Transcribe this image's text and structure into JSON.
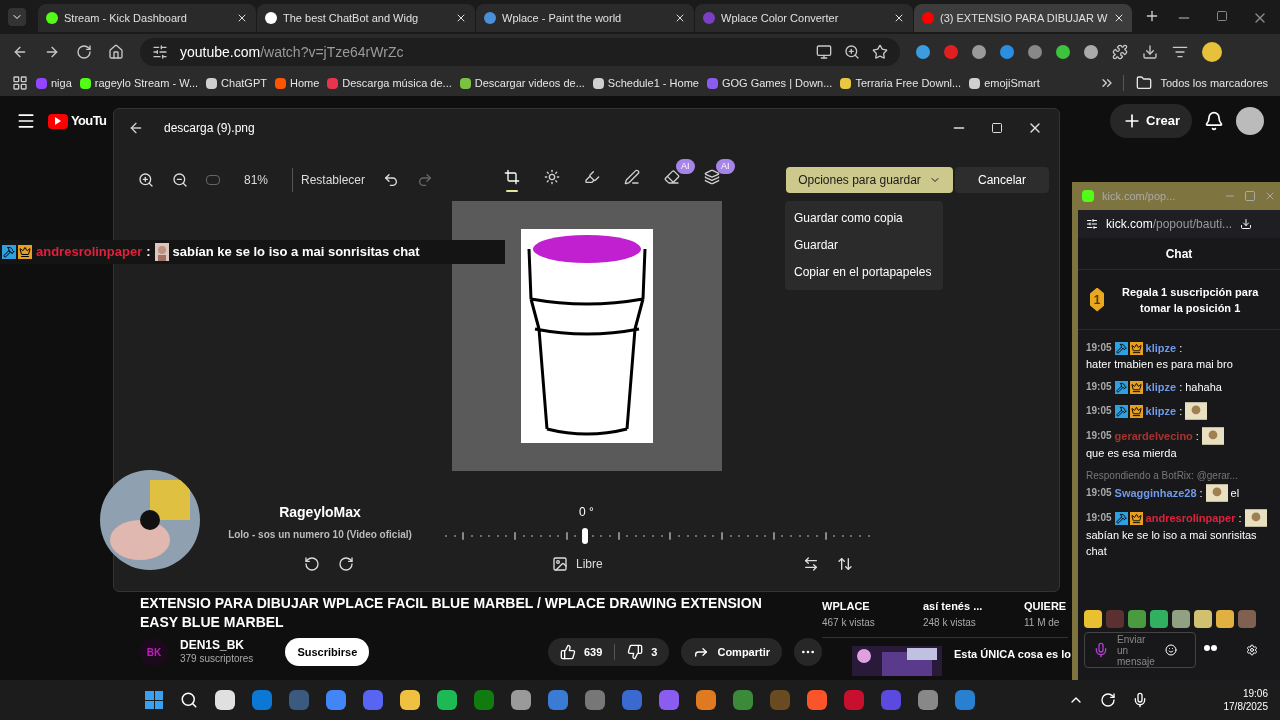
{
  "browser": {
    "tabs": [
      {
        "title": "Stream - Kick Dashboard",
        "selected": false,
        "color": "#53fc18"
      },
      {
        "title": "The best ChatBot and Widg",
        "selected": false,
        "color": "#ffffff"
      },
      {
        "title": "Wplace - Paint the world",
        "selected": false,
        "color": "#4a90d9"
      },
      {
        "title": "Wplace Color Converter",
        "selected": false,
        "color": "#7b3fc4"
      },
      {
        "title": "(3) EXTENSIO PARA DIBUJAR W",
        "selected": true,
        "color": "#ff0000"
      }
    ],
    "url_domain": "youtube.com",
    "url_path": "/watch?v=jTze64rWrZc",
    "bookmarks": [
      {
        "label": "niga",
        "color": "#9146ff"
      },
      {
        "label": "rageylo Stream - W...",
        "color": "#53fc18"
      },
      {
        "label": "ChatGPT",
        "color": "#d0d0d0"
      },
      {
        "label": "Home",
        "color": "#ff5500"
      },
      {
        "label": "Descarga música de...",
        "color": "#e8344e"
      },
      {
        "label": "Descargar videos de...",
        "color": "#7cc242"
      },
      {
        "label": "Schedule1 - Home",
        "color": "#d0d0d0"
      },
      {
        "label": "GOG Games | Down...",
        "color": "#8a5cf0"
      },
      {
        "label": "Terraria Free Downl...",
        "color": "#e8c840"
      },
      {
        "label": "emojiSmart",
        "color": "#d0d0d0"
      }
    ],
    "all_bookmarks": "Todos los marcadores"
  },
  "youtube": {
    "logo": "YouTu",
    "create": "Crear",
    "video_title": "EXTENSIO PARA DIBUJAR WPLACE FACIL BLUE MARBEL / WPLACE DRAWING EXTENSION EASY BLUE MARBEL",
    "channel": "DEN1S_BK",
    "channel_initials": "BK",
    "subscribers": "379 suscriptores",
    "subscribe": "Suscribirse",
    "likes": "639",
    "dislikes": "3",
    "share": "Compartir",
    "suggested": [
      {
        "title": "WPLACE",
        "views": "467 k vistas"
      },
      {
        "title": "así tenés ...",
        "views": "248 k vistas"
      },
      {
        "title": "QUIERE",
        "views": "11 M de"
      }
    ],
    "next_video_title": "Esta ÚNICA cosa es lo"
  },
  "photo_editor": {
    "file_name": "descarga (9).png",
    "zoom": "81%",
    "reset": "Restablecer",
    "tools": [
      {
        "kind": "crop",
        "selected": true
      },
      {
        "kind": "adjust",
        "selected": false
      },
      {
        "kind": "filter",
        "selected": false
      },
      {
        "kind": "markup",
        "selected": false
      },
      {
        "kind": "erase",
        "selected": false,
        "badge": "AI"
      },
      {
        "kind": "background",
        "selected": false,
        "badge": "AI"
      }
    ],
    "save_options": "Opciones para guardar",
    "cancel": "Cancelar",
    "save_menu": [
      "Guardar como copia",
      "Guardar",
      "Copiar en el portapapeles"
    ],
    "angle": "0 °",
    "angle_slider": {
      "level": 0.33
    },
    "aspect": "Libre"
  },
  "stream_overlay": {
    "chat_user": "andresrolinpaper",
    "chat_separator": ":",
    "chat_message": "sabían ke se lo iso a mai sonrisitas chat",
    "now_playing_artist": "RageyloMax",
    "now_playing_song": "Lolo - sos un numero 10 (Video oficial)"
  },
  "kick_popout": {
    "window_title": "kick.com/pop...",
    "url_domain": "kick.com",
    "url_path": "/popout/bauti...",
    "heading": "Chat",
    "gift_rank": "1",
    "gift_text": "Regala 1 suscripción para tomar la posición 1",
    "messages": [
      {
        "time": "19:05",
        "badges": true,
        "user": "klipze",
        "color": "#6f9bea",
        "separator": ":",
        "text": "hater tmabien es para mai bro",
        "emote": false
      },
      {
        "time": "19:05",
        "badges": true,
        "user": "klipze",
        "color": "#6f9bea",
        "separator": ":",
        "text": "hahaha",
        "emote": false
      },
      {
        "time": "19:05",
        "badges": true,
        "user": "klipze",
        "color": "#6f9bea",
        "separator": ":",
        "emote": true
      },
      {
        "time": "19:05",
        "badges": false,
        "user": "gerardelvecino",
        "color": "#a8322e",
        "separator": ":",
        "text": "que es esa mierda",
        "emote": true
      },
      {
        "time": "19:05",
        "badges": false,
        "reply": "Respondiendo a BotRix: @gerar...",
        "user": "Swagginhaze28",
        "color": "#6f9bea",
        "separator": ":",
        "text": "el",
        "emote": true
      },
      {
        "time": "19:05",
        "badges": true,
        "user": "andresrolinpaper",
        "color": "#e0203c",
        "separator": ":",
        "text": "sabían ke se lo iso a mai sonrisitas chat",
        "emote": true
      }
    ],
    "input_placeholder": "Enviar un mensaje"
  },
  "taskbar": {
    "time": "19:06",
    "date": "17/8/2025"
  }
}
